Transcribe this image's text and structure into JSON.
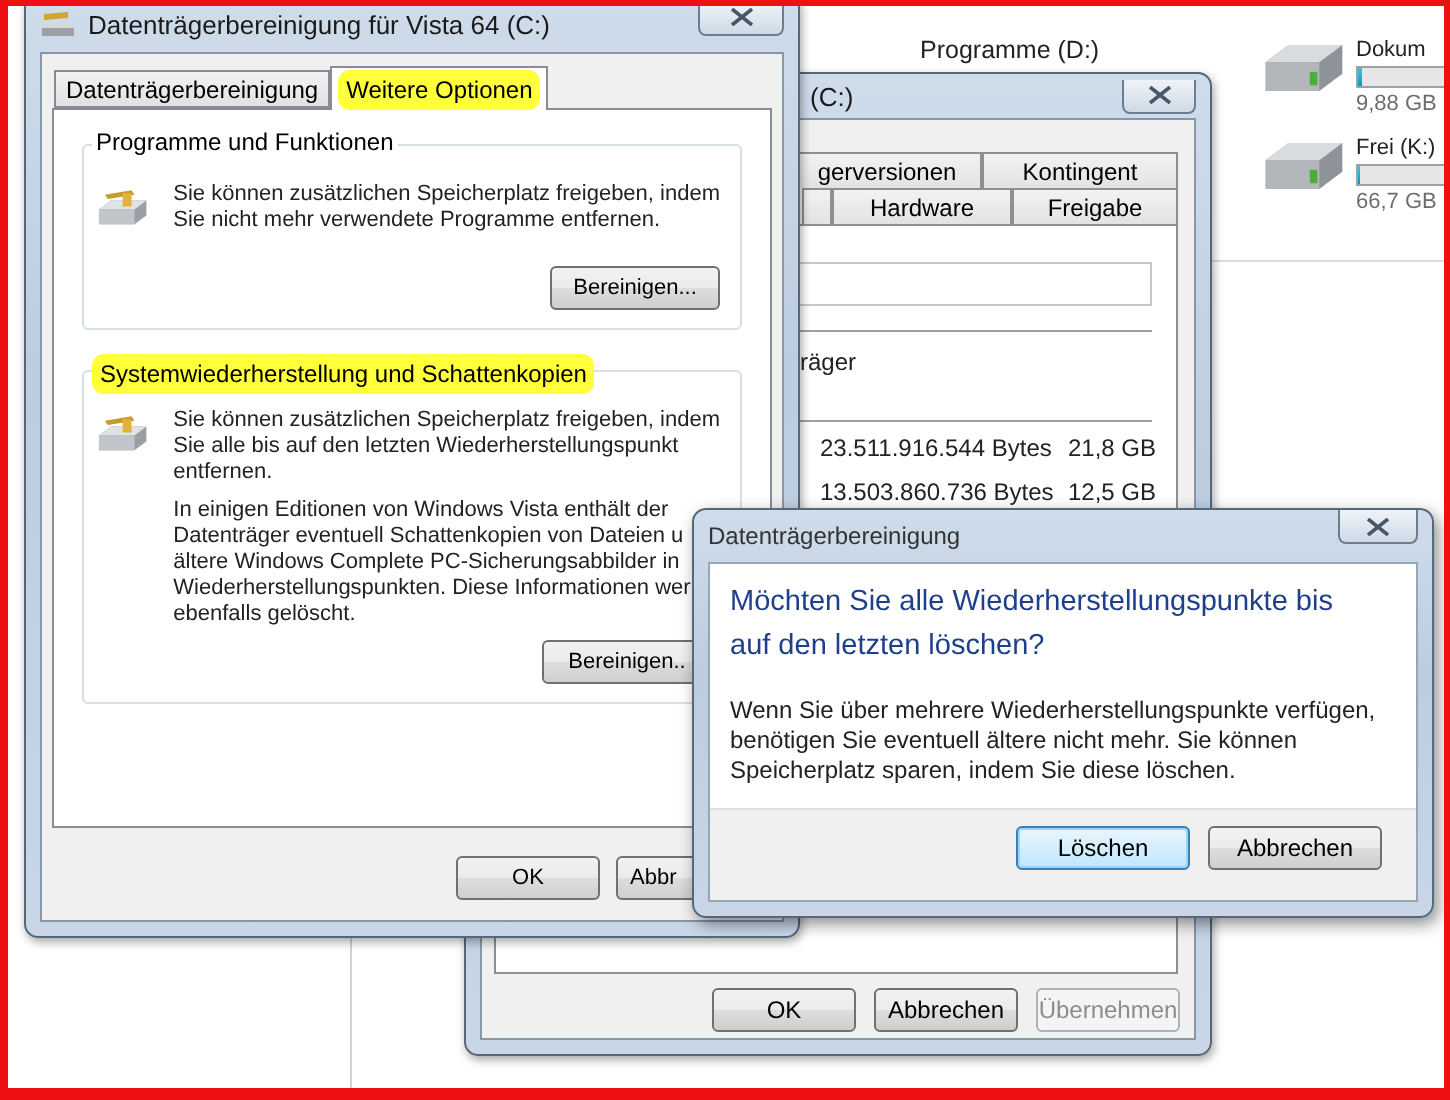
{
  "explorer": {
    "drive_label": "Programme (D:)",
    "drives": [
      {
        "name": "Dokum",
        "level": 0.05,
        "free": "9,88 GB"
      },
      {
        "name": "Frei (K:)",
        "level": 0.02,
        "free": "66,7 GB"
      }
    ]
  },
  "properties_window": {
    "title": "(C:)",
    "tab_rows": [
      [
        {
          "label": "gerversionen"
        },
        {
          "label": "Kontingent"
        }
      ],
      [
        {
          "label": "Hardware"
        },
        {
          "label": "Freigabe"
        }
      ]
    ],
    "type_label": "räger",
    "rows": [
      {
        "bytes": "23.511.916.544 Bytes",
        "size": "21,8 GB"
      },
      {
        "bytes": "13.503.860.736 Bytes",
        "size": "12,5 GB"
      }
    ],
    "buttons": [
      {
        "label": "OK",
        "disabled": false
      },
      {
        "label": "Abbrechen",
        "disabled": false
      },
      {
        "label": "Übernehmen",
        "disabled": true
      }
    ]
  },
  "cleanup_window": {
    "title": "Datenträgerbereinigung für Vista 64 (C:)",
    "tabs": [
      {
        "label": "Datenträgerbereinigung",
        "selected": false,
        "highlighted": false
      },
      {
        "label": "Weitere Optionen",
        "selected": true,
        "highlighted": true
      }
    ],
    "groups": [
      {
        "title": "Programme und Funktionen",
        "highlighted": false,
        "paragraphs": [
          [
            "Sie können zusätzlichen Speicherplatz freigeben, indem",
            "Sie nicht mehr verwendete Programme entfernen."
          ]
        ],
        "button": "Bereinigen..."
      },
      {
        "title": "Systemwiederherstellung und Schattenkopien",
        "highlighted": true,
        "paragraphs": [
          [
            "Sie können zusätzlichen Speicherplatz freigeben, indem",
            "Sie alle bis auf den letzten Wiederherstellungspunkt",
            "entfernen."
          ],
          [
            "In einigen Editionen von Windows Vista enthält der",
            "Datenträger eventuell Schattenkopien von Dateien u",
            "ältere Windows Complete PC-Sicherungsabbilder in",
            "Wiederherstellungspunkten. Diese Informationen wer",
            "ebenfalls gelöscht."
          ]
        ],
        "button": "Bereinigen.."
      }
    ],
    "buttons": [
      "OK",
      "Abbr"
    ]
  },
  "dialog": {
    "title": "Datenträgerbereinigung",
    "question": [
      "Möchten Sie alle Wiederherstellungspunkte bis",
      "auf den letzten löschen?"
    ],
    "body": [
      "Wenn Sie über mehrere Wiederherstellungspunkte verfügen,",
      "benötigen Sie eventuell ältere nicht mehr. Sie können",
      "Speicherplatz sparen, indem Sie diese löschen."
    ],
    "buttons": [
      {
        "label": "Löschen",
        "default": true
      },
      {
        "label": "Abbrechen",
        "default": false
      }
    ]
  }
}
